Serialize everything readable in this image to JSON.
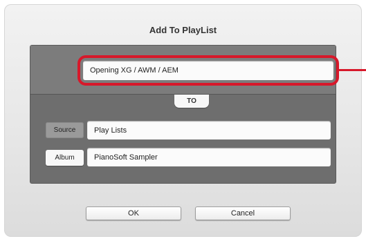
{
  "dialog": {
    "title": "Add To PlayList",
    "selected_song": "Opening XG / AWM / AEM",
    "to_label": "TO",
    "source_button": "Source",
    "source_value": "Play Lists",
    "album_button": "Album",
    "album_value": "PianoSoft Sampler",
    "ok_label": "OK",
    "cancel_label": "Cancel"
  },
  "colors": {
    "highlight": "#d7182a",
    "panel": "#6e6e6e"
  }
}
